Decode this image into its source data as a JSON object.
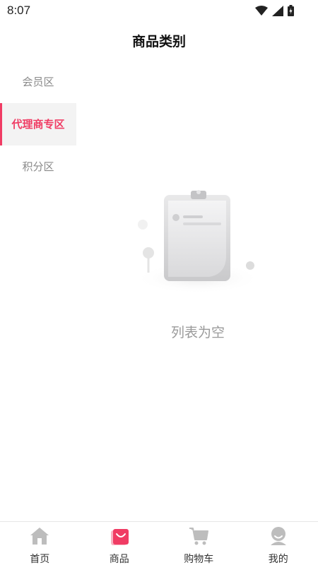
{
  "status_bar": {
    "time": "8:07"
  },
  "header": {
    "title": "商品类别"
  },
  "sidebar": {
    "items": [
      {
        "label": "会员区",
        "active": false
      },
      {
        "label": "代理商专区",
        "active": true
      },
      {
        "label": "积分区",
        "active": false
      }
    ]
  },
  "empty_state": {
    "message": "列表为空",
    "icon": "empty-clipboard-icon"
  },
  "tabbar": {
    "items": [
      {
        "label": "首页",
        "icon": "home-icon"
      },
      {
        "label": "商品",
        "icon": "shopping-bag-icon",
        "active": true
      },
      {
        "label": "购物车",
        "icon": "cart-icon"
      },
      {
        "label": "我的",
        "icon": "user-icon"
      }
    ]
  },
  "colors": {
    "accent": "#f03c64",
    "inactive_icon": "#bdbdbd",
    "sidebar_active_bg": "#f3f3f3"
  }
}
